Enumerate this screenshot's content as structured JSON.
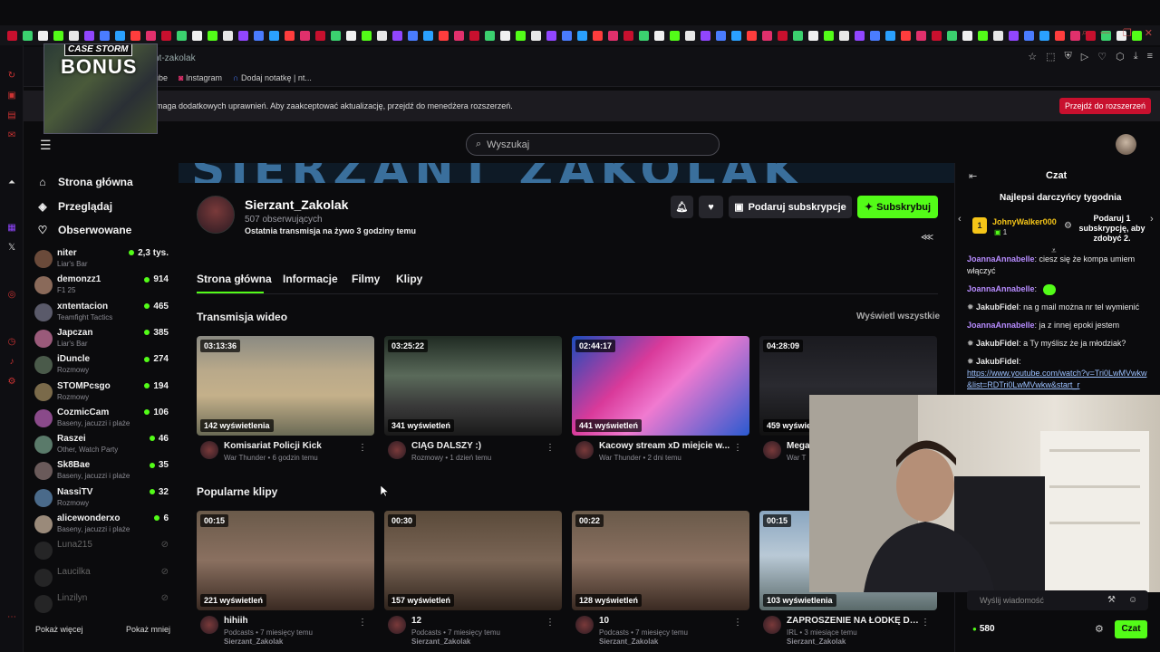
{
  "browser": {
    "address_partial": "nt-zakolak",
    "bookmarks": [
      "ube",
      "Instagram",
      "Dodaj notatkę | nt..."
    ],
    "notice_text": "maga dodatkowych uprawnień. Aby zaakceptować aktualizację, przejdź do menedżera rozszerzeń.",
    "notice_button": "Przejdź do rozszerzeń"
  },
  "overlay": {
    "brand": "CASE STORM",
    "label": "BONUS"
  },
  "header": {
    "search_placeholder": "Wyszukaj"
  },
  "nav": {
    "home": "Strona główna",
    "browse": "Przeglądaj",
    "following": "Obserwowane",
    "show_more": "Pokaż więcej",
    "show_less": "Pokaż mniej"
  },
  "followed": [
    {
      "name": "niter",
      "category": "Liar's Bar",
      "viewers": "2,3 tys.",
      "online": true
    },
    {
      "name": "demonzz1",
      "category": "F1 25",
      "viewers": "914",
      "online": true
    },
    {
      "name": "xntentacion",
      "category": "Teamfight Tactics",
      "viewers": "465",
      "online": true
    },
    {
      "name": "Japczan",
      "category": "Liar's Bar",
      "viewers": "385",
      "online": true
    },
    {
      "name": "iDuncle",
      "category": "Rozmowy",
      "viewers": "274",
      "online": true
    },
    {
      "name": "STOMPcsgo",
      "category": "Rozmowy",
      "viewers": "194",
      "online": true
    },
    {
      "name": "CozmicCam",
      "category": "Baseny, jacuzzi i plaże",
      "viewers": "106",
      "online": true
    },
    {
      "name": "Raszei",
      "category": "Other, Watch Party",
      "viewers": "46",
      "online": true
    },
    {
      "name": "Sk8Bae",
      "category": "Baseny, jacuzzi i plaże",
      "viewers": "35",
      "online": true
    },
    {
      "name": "NassiTV",
      "category": "Rozmowy",
      "viewers": "32",
      "online": true
    },
    {
      "name": "alicewonderxo",
      "category": "Baseny, jacuzzi i plaże",
      "viewers": "6",
      "online": true
    },
    {
      "name": "Luna215",
      "category": "",
      "viewers": "",
      "online": false
    },
    {
      "name": "Laucilka",
      "category": "",
      "viewers": "",
      "online": false
    },
    {
      "name": "Linzilyn",
      "category": "",
      "viewers": "",
      "online": false
    }
  ],
  "channel": {
    "banner_text": "SIERZANT ZAKOLAK",
    "name": "Sierzant_Zakolak",
    "followers": "507 obserwujących",
    "last_stream": "Ostatnia transmisja na żywo 3 godziny temu",
    "gift_button": "Podaruj subskrypcje",
    "subscribe_button": "Subskrybuj",
    "tabs": [
      "Strona główna",
      "Informacje",
      "Filmy",
      "Klipy"
    ]
  },
  "vods": {
    "title": "Transmisja wideo",
    "see_all": "Wyświetl wszystkie",
    "items": [
      {
        "duration": "03:13:36",
        "views": "142 wyświetlenia",
        "title": "Komisariat Policji Kick",
        "meta": "War Thunder • 6 godzin temu"
      },
      {
        "duration": "03:25:22",
        "views": "341 wyświetleń",
        "title": "CIĄG DALSZY :)",
        "meta": "Rozmowy • 1 dzień temu"
      },
      {
        "duration": "02:44:17",
        "views": "441 wyświetleń",
        "title": "Kacowy stream xD miejcie w...",
        "meta": "War Thunder • 2 dni temu"
      },
      {
        "duration": "04:28:09",
        "views": "459 wyświe",
        "title": "Mega",
        "meta": "War T"
      }
    ]
  },
  "clips": {
    "title": "Popularne klipy",
    "items": [
      {
        "duration": "00:15",
        "views": "221 wyświetleń",
        "title": "hihiih",
        "meta": "Podcasts • 7 miesięcy temu",
        "author": "Sierzant_Zakolak"
      },
      {
        "duration": "00:30",
        "views": "157 wyświetleń",
        "title": "12",
        "meta": "Podcasts • 7 miesięcy temu",
        "author": "Sierzant_Zakolak"
      },
      {
        "duration": "00:22",
        "views": "128 wyświetleń",
        "title": "10",
        "meta": "Podcasts • 7 miesięcy temu",
        "author": "Sierzant_Zakolak"
      },
      {
        "duration": "00:15",
        "views": "103 wyświetlenia",
        "title": "ZAPROSZENIE NA ŁÓDKĘ DL...",
        "meta": "IRL • 3 miesiące temu",
        "author": "Sierzant_Zakolak"
      }
    ]
  },
  "chat": {
    "title": "Czat",
    "top_donors_title": "Najlepsi darczyńcy tygodnia",
    "donor_rank": "1",
    "donor_name": "JohnyWalker000",
    "donor_count": "1",
    "donor_cta": "Podaruj 1 subskrypcję, aby zdobyć 2.",
    "messages": [
      {
        "user": "JoannaAnnabelle",
        "text": ": ciesz się że kompa umiem włączyć"
      },
      {
        "user": "JoannaAnnabelle",
        "text": ":"
      },
      {
        "user": "JakubFidel",
        "text": ": na g mail można nr tel wymienić"
      },
      {
        "user": "JoannaAnnabelle",
        "text": ": ja z innej epoki jestem"
      },
      {
        "user": "JakubFidel",
        "text": ": a Ty myślisz że ja młodziak?"
      },
      {
        "user": "JakubFidel",
        "text": ":"
      }
    ],
    "link": "https://www.youtube.com/watch?v=Tri0LwMVwkw&list=RDTri0LwMVwkw&start_r",
    "input_placeholder": "Wyślij wiadomość",
    "points": "580",
    "send_button": "Czat"
  },
  "colors": {
    "accent": "#53fc18",
    "username_violet": "#b78cff",
    "donor_gold": "#f5c518",
    "notice_red": "#c8102e"
  }
}
